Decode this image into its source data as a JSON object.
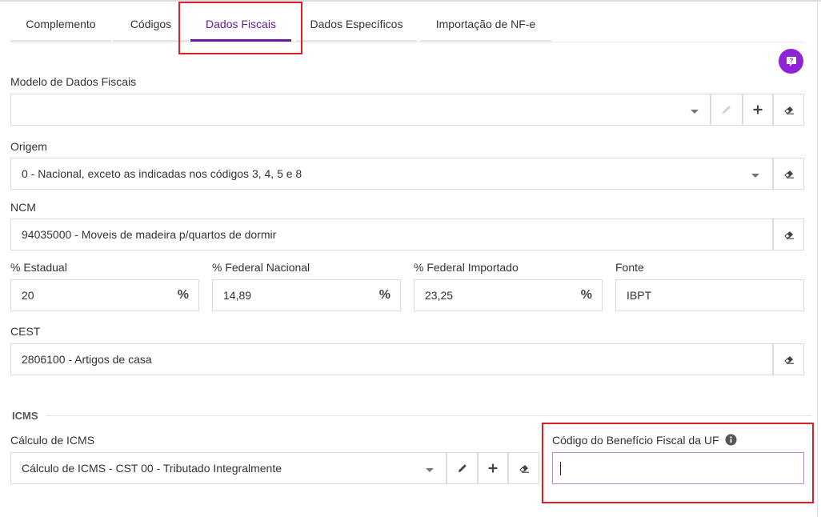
{
  "tabs": [
    {
      "label": "Complemento"
    },
    {
      "label": "Códigos"
    },
    {
      "label": "Dados Fiscais"
    },
    {
      "label": "Dados Específicos"
    },
    {
      "label": "Importação de NF-e"
    }
  ],
  "accent_color": "#6a1b9a",
  "highlight_color": "#e01e24",
  "modelo": {
    "label": "Modelo de Dados Fiscais",
    "value": ""
  },
  "origem": {
    "label": "Origem",
    "value": "0 - Nacional, exceto as indicadas nos códigos 3, 4, 5 e 8"
  },
  "ncm": {
    "label": "NCM",
    "value": "94035000 - Moveis de madeira p/quartos de dormir"
  },
  "estadual": {
    "label": "% Estadual",
    "value": "20",
    "unit": "%"
  },
  "federal_nacional": {
    "label": "% Federal Nacional",
    "value": "14,89",
    "unit": "%"
  },
  "federal_importado": {
    "label": "% Federal Importado",
    "value": "23,25",
    "unit": "%"
  },
  "fonte": {
    "label": "Fonte",
    "value": "IBPT"
  },
  "cest": {
    "label": "CEST",
    "value": "2806100 - Artigos de casa"
  },
  "icms": {
    "section_title": "ICMS",
    "calculo_label": "Cálculo de ICMS",
    "calculo_value": "Cálculo de ICMS - CST 00 - Tributado Integralmente",
    "beneficio_label": "Código do Benefício Fiscal da UF",
    "beneficio_value": ""
  }
}
